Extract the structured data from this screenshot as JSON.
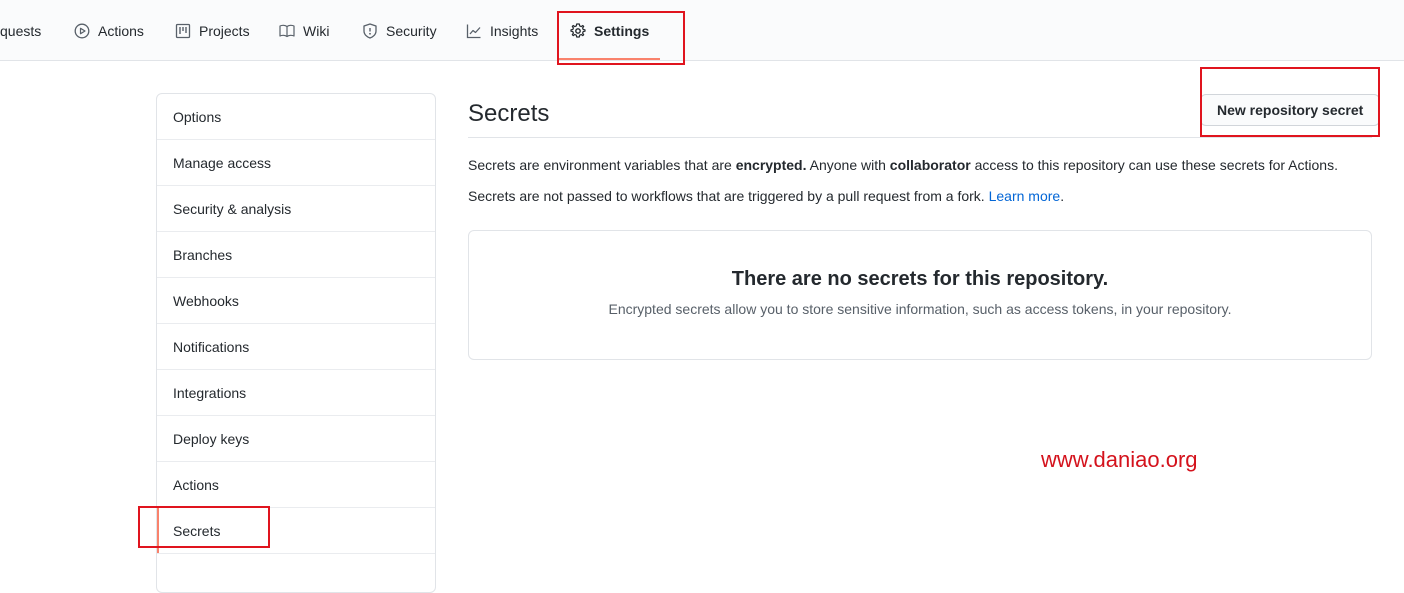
{
  "tabs": [
    {
      "label": "quests",
      "icon": "pull-request-icon"
    },
    {
      "label": "Actions",
      "icon": "play-icon"
    },
    {
      "label": "Projects",
      "icon": "project-icon"
    },
    {
      "label": "Wiki",
      "icon": "book-icon"
    },
    {
      "label": "Security",
      "icon": "shield-icon"
    },
    {
      "label": "Insights",
      "icon": "graph-icon"
    },
    {
      "label": "Settings",
      "icon": "gear-icon",
      "selected": true
    }
  ],
  "sidebar": {
    "items": [
      {
        "label": "Options"
      },
      {
        "label": "Manage access"
      },
      {
        "label": "Security & analysis"
      },
      {
        "label": "Branches"
      },
      {
        "label": "Webhooks"
      },
      {
        "label": "Notifications"
      },
      {
        "label": "Integrations"
      },
      {
        "label": "Deploy keys"
      },
      {
        "label": "Actions"
      },
      {
        "label": "Secrets",
        "selected": true
      }
    ]
  },
  "main": {
    "title": "Secrets",
    "new_secret_button": "New repository secret",
    "intro": {
      "part1": "Secrets are environment variables that are ",
      "bold1": "encrypted.",
      "part2": " Anyone with ",
      "bold2": "collaborator",
      "part3": " access to this repository can use these secrets for Actions."
    },
    "fork_note": {
      "text": "Secrets are not passed to workflows that are triggered by a pull request from a fork. ",
      "link": "Learn more",
      "end": "."
    },
    "blankslate": {
      "title": "There are no secrets for this repository.",
      "description": "Encrypted secrets allow you to store sensitive information, such as access tokens, in your repository."
    }
  },
  "watermark": "www.daniao.org",
  "colors": {
    "accent_underline": "#f9826c",
    "highlight_box": "#e0141e",
    "link": "#0366d6",
    "watermark": "#d4121c"
  }
}
